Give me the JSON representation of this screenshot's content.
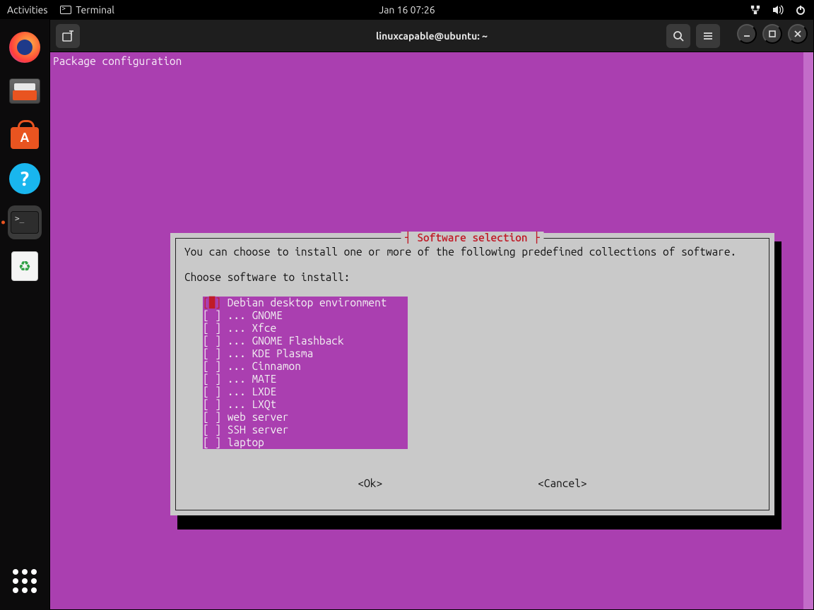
{
  "panel": {
    "activities": "Activities",
    "app_label": "Terminal",
    "clock": "Jan 16  07:26"
  },
  "window": {
    "title": "linuxcapable@ubuntu: ~"
  },
  "terminal": {
    "pkgconf": "Package configuration"
  },
  "dialog": {
    "title": " Software selection ",
    "text": "You can choose to install one or more of the following predefined collections of software.",
    "prompt": "Choose software to install:",
    "ok": "<Ok>",
    "cancel": "<Cancel>",
    "items": [
      "Debian desktop environment",
      "... GNOME",
      "... Xfce",
      "... GNOME Flashback",
      "... KDE Plasma",
      "... Cinnamon",
      "... MATE",
      "... LXDE",
      "... LXQt",
      "web server",
      "SSH server",
      "laptop"
    ]
  },
  "dock": {
    "firefox": "Firefox",
    "files": "Files",
    "software": "Ubuntu Software",
    "help": "Help",
    "terminal": "Terminal",
    "trash": "Trash",
    "apps": "Show Applications"
  }
}
